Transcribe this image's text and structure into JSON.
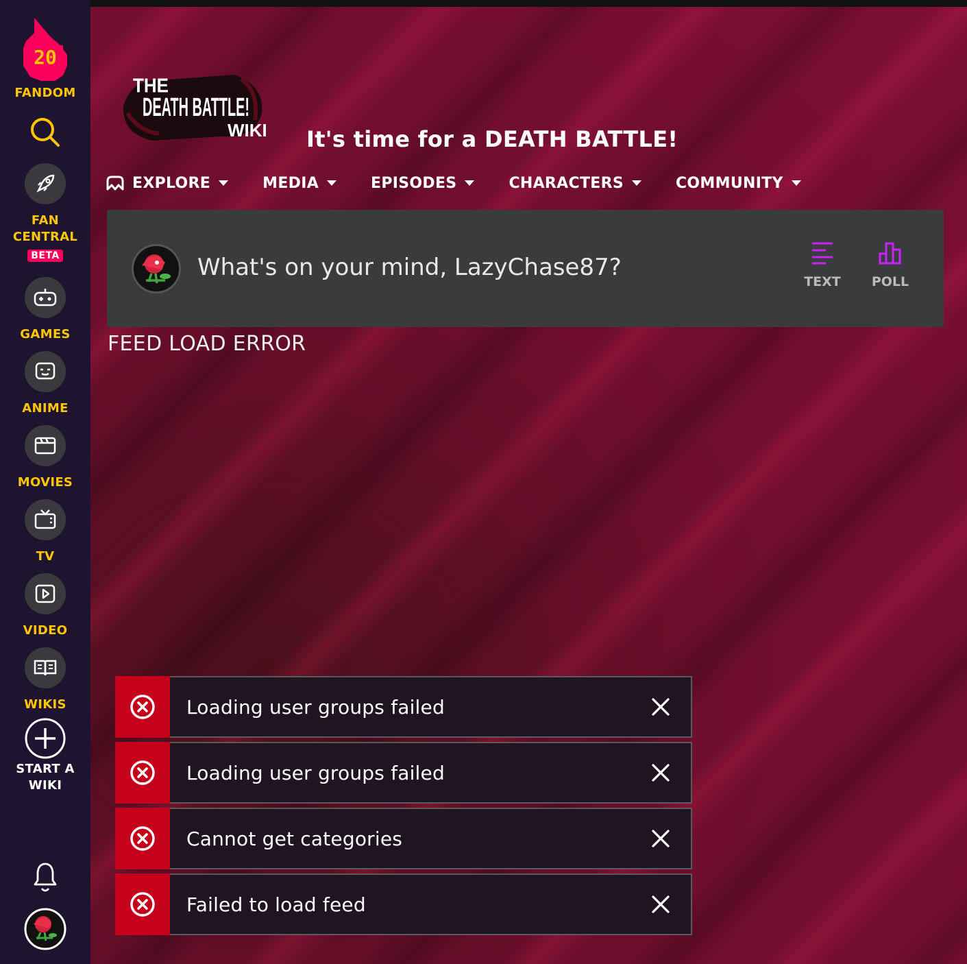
{
  "rail": {
    "brand_label": "FANDOM",
    "brand_badge_number": "20",
    "items": [
      {
        "label": "FAN CENTRAL",
        "icon": "rocket-icon",
        "badge": "BETA"
      },
      {
        "label": "GAMES",
        "icon": "gamepad-icon"
      },
      {
        "label": "ANIME",
        "icon": "anime-face-icon"
      },
      {
        "label": "MOVIES",
        "icon": "clapperboard-icon"
      },
      {
        "label": "TV",
        "icon": "tv-icon"
      },
      {
        "label": "VIDEO",
        "icon": "play-icon"
      },
      {
        "label": "WIKIS",
        "icon": "book-icon"
      }
    ],
    "start_wiki": {
      "line1": "START A",
      "line2": "WIKI"
    },
    "accent_color": "#ffc500"
  },
  "header": {
    "logo_text": {
      "line1": "THE",
      "line2": "DEATH BATTLE!",
      "line3": "WIKI"
    },
    "tagline": "It's time for a DEATH BATTLE!"
  },
  "nav": [
    {
      "label": "EXPLORE"
    },
    {
      "label": "MEDIA"
    },
    {
      "label": "EPISODES"
    },
    {
      "label": "CHARACTERS"
    },
    {
      "label": "COMMUNITY"
    }
  ],
  "composer": {
    "prompt": "What's on your mind, LazyChase87?",
    "actions": [
      {
        "label": "TEXT",
        "icon": "text-lines-icon"
      },
      {
        "label": "POLL",
        "icon": "poll-chart-icon"
      }
    ],
    "accent_color": "#c822ff"
  },
  "feed_error": "FEED LOAD ERROR",
  "toasts": [
    {
      "message": "Loading user groups failed"
    },
    {
      "message": "Loading user groups failed"
    },
    {
      "message": "Cannot get categories"
    },
    {
      "message": "Failed to load feed"
    }
  ],
  "colors": {
    "toast_error": "#c4001b",
    "fandom_pink": "#fa005a"
  }
}
